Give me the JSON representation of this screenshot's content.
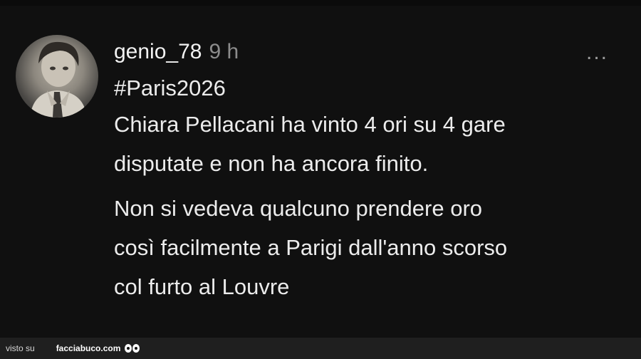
{
  "post": {
    "username": "genio_78",
    "time": "9 h",
    "more_label": "...",
    "hashtag": "#Paris2026",
    "paragraph1_lines": [
      "Chiara Pellacani ha vinto 4 ori su 4 gare",
      "disputate e non ha ancora finito."
    ],
    "paragraph2_lines": [
      "Non si vedeva qualcuno prendere oro",
      "così facilmente a Parigi dall'anno scorso",
      "col furto al Louvre"
    ]
  },
  "footer": {
    "visto_su": "visto su",
    "brand": "facciabuco.com"
  },
  "icons": {
    "avatar": "user-avatar-photo",
    "more": "more-options-icon",
    "eyes": "eyes-logo-icon"
  }
}
